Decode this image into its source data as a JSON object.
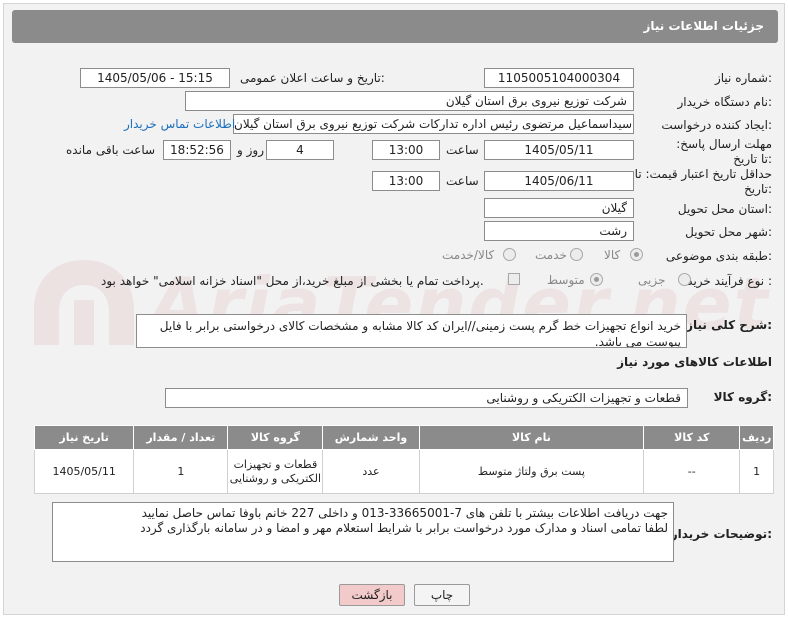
{
  "header": {
    "title": "جزئیات اطلاعات نیاز"
  },
  "fields": {
    "need_number_label": "شماره نیاز:",
    "need_number": "1105005104000304",
    "announce_label": "تاریخ و ساعت اعلان عمومی:",
    "announce_value": "1405/05/06 - 15:15",
    "buyer_org_label": "نام دستگاه خریدار:",
    "buyer_org": "شرکت توزیع نیروی برق استان گیلان",
    "creator_label": "ایجاد کننده درخواست:",
    "creator": "سیداسماعیل مرتضوی رئیس اداره تدارکات شرکت توزیع نیروی برق استان گیلان",
    "contact_link": "اطلاعات تماس خریدار",
    "deadline_label": "مهلت ارسال پاسخ: تا تاریخ:",
    "deadline_date": "1405/05/11",
    "time_label": "ساعت",
    "deadline_time": "13:00",
    "days": "4",
    "days_label": "روز و",
    "remaining_time": "18:52:56",
    "remaining_label": "ساعت باقی مانده",
    "validity_label": "حداقل تاریخ اعتبار قیمت: تا تاریخ:",
    "validity_date": "1405/06/11",
    "validity_time": "13:00",
    "province_label": "استان محل تحویل:",
    "province": "گیلان",
    "city_label": "شهر محل تحویل:",
    "city": "رشت",
    "category_label": "طبقه بندی موضوعی:",
    "category_options": [
      "کالا",
      "خدمت",
      "کالا/خدمت"
    ],
    "purchase_type_label": "نوع فرآیند خرید :",
    "purchase_options": [
      "جزیی",
      "متوسط"
    ],
    "payment_note": "پرداخت تمام یا بخشی از مبلغ خرید،از محل \"اسناد خزانه اسلامی\" خواهد بود."
  },
  "description": {
    "label": "شرح کلی نیاز:",
    "text": "خرید انواع تجهیزات خط گرم پست زمینی//ایران کد کالا مشابه و مشخصات کالای درخواستی برابر با فایل پیوست می باشد."
  },
  "goods": {
    "section_title": "اطلاعات کالاهای مورد نیاز",
    "group_label": "گروه کالا:",
    "group_value": "قطعات و تجهیزات الکتریکی و روشنایی",
    "columns": [
      "ردیف",
      "کد کالا",
      "نام کالا",
      "واحد شمارش",
      "گروه کالا",
      "تعداد / مقدار",
      "تاریخ نیاز"
    ],
    "rows": [
      {
        "row": "1",
        "code": "--",
        "name": "پست برق ولتاژ متوسط",
        "unit": "عدد",
        "group": "قطعات و تجهیزات الکتریکی و روشنایی",
        "qty": "1",
        "date": "1405/05/11"
      }
    ]
  },
  "buyer_notes": {
    "label": "توضیحات خریدار:",
    "line1": "جهت دریافت اطلاعات بیشتر با تلفن های 7-33665001-013 و داخلی 227 خانم باوفا تماس حاصل نمایید",
    "line2": "لطفا تمامی اسناد و مدارک مورد درخواست برابر با شرایط استعلام مهر و امضا و در سامانه بارگذاری گردد"
  },
  "buttons": {
    "back": "بازگشت",
    "print": "چاپ"
  },
  "colors": {
    "header_bg": "#8b8b8b",
    "link": "#1c6fbd",
    "back_btn": "#f3caca"
  }
}
